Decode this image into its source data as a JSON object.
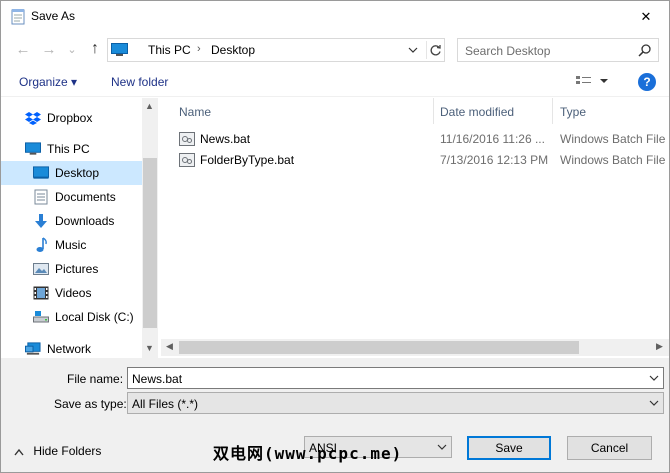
{
  "window": {
    "title": "Save As",
    "close_glyph": "✕"
  },
  "nav": {
    "back_glyph": "←",
    "forward_glyph": "→",
    "recent_glyph": "⌄",
    "up_glyph": "↑",
    "breadcrumbs": [
      "This PC",
      "Desktop"
    ],
    "crumb_sep": "›",
    "search_placeholder": "Search Desktop"
  },
  "toolbar": {
    "organize_label": "Organize ▾",
    "new_folder_label": "New folder",
    "help_label": "?"
  },
  "sidebar": {
    "items": [
      {
        "label": "Dropbox",
        "icon": "dropbox-icon"
      },
      {
        "label": "This PC",
        "icon": "pc-icon"
      },
      {
        "label": "Desktop",
        "icon": "desktop-icon",
        "selected": true
      },
      {
        "label": "Documents",
        "icon": "documents-icon"
      },
      {
        "label": "Downloads",
        "icon": "downloads-icon"
      },
      {
        "label": "Music",
        "icon": "music-icon"
      },
      {
        "label": "Pictures",
        "icon": "pictures-icon"
      },
      {
        "label": "Videos",
        "icon": "videos-icon"
      },
      {
        "label": "Local Disk (C:)",
        "icon": "drive-icon"
      },
      {
        "label": "Network",
        "icon": "network-icon"
      }
    ]
  },
  "files": {
    "columns": [
      "Name",
      "Date modified",
      "Type"
    ],
    "rows": [
      {
        "name": "News.bat",
        "date": "11/16/2016 11:26 ...",
        "type": "Windows Batch File"
      },
      {
        "name": "FolderByType.bat",
        "date": "7/13/2016 12:13 PM",
        "type": "Windows Batch File"
      }
    ]
  },
  "form": {
    "filename_label": "File name:",
    "filename_value": "News.bat",
    "savetype_label": "Save as type:",
    "savetype_value": "All Files  (*.*)",
    "encoding_value": "ANSI"
  },
  "footer": {
    "hide_folders_label": "Hide Folders",
    "save_label": "Save",
    "cancel_label": "Cancel",
    "watermark": "双电网(www.pcpc.me)"
  },
  "colors": {
    "accent": "#0078d7",
    "selection": "#cce8ff",
    "link": "#1e3287"
  }
}
